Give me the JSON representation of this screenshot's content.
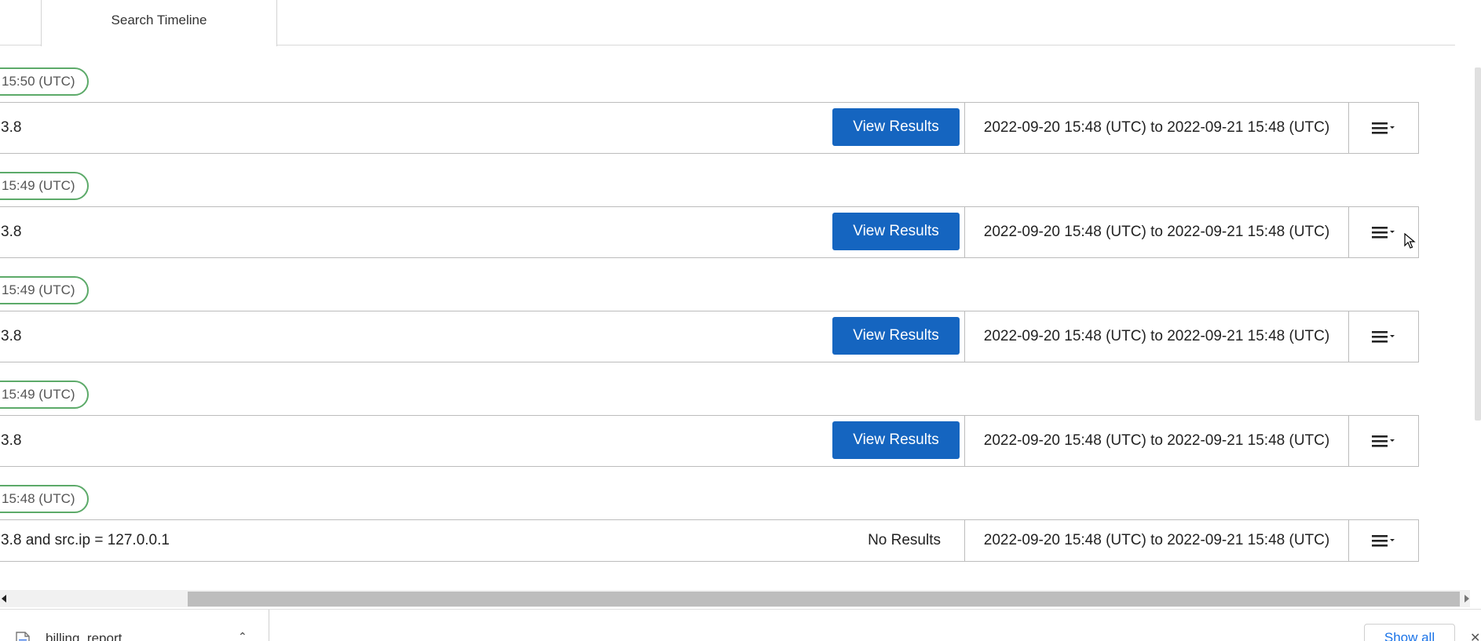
{
  "tabs": {
    "active_label": "Search Timeline"
  },
  "timeline": {
    "entries": [
      {
        "timestamp": "15:50 (UTC)",
        "query": "3.8",
        "result_label": "View Results",
        "range": "2022-09-20 15:48 (UTC) to 2022-09-21 15:48 (UTC)"
      },
      {
        "timestamp": "15:49 (UTC)",
        "query": "3.8",
        "result_label": "View Results",
        "range": "2022-09-20 15:48 (UTC) to 2022-09-21 15:48 (UTC)"
      },
      {
        "timestamp": "15:49 (UTC)",
        "query": "3.8",
        "result_label": "View Results",
        "range": "2022-09-20 15:48 (UTC) to 2022-09-21 15:48 (UTC)"
      },
      {
        "timestamp": "15:49 (UTC)",
        "query": "3.8",
        "result_label": "View Results",
        "range": "2022-09-20 15:48 (UTC) to 2022-09-21 15:48 (UTC)"
      },
      {
        "timestamp": "15:48 (UTC)",
        "query": "3.8 and src.ip = 127.0.0.1",
        "result_label": "No Results",
        "range": "2022-09-20 15:48 (UTC) to 2022-09-21 15:48 (UTC)"
      }
    ],
    "menu_icon": "hamburger-dropdown-icon"
  },
  "downloads": {
    "file_name": "billing_report",
    "show_all_label": "Show all"
  },
  "colors": {
    "button_blue": "#1565c0",
    "pill_border_green": "#5caa69",
    "row_border": "#bcbcbc",
    "link_blue": "#1a73e8"
  }
}
